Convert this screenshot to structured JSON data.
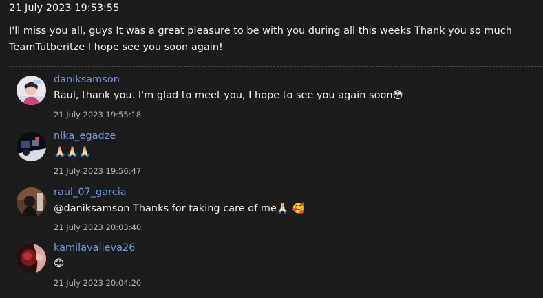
{
  "post": {
    "timestamp": "21 July 2023 19:53:55",
    "text_line1": "I'll miss you all, guys It was a great pleasure to be with you during all this weeks Thank you so much",
    "text_line2": "TeamTutberitze I hope see you soon again!"
  },
  "replies": [
    {
      "author": "daniksamson",
      "text": "Raul, thank you. I'm glad to meet you, I hope to see you again soon😳",
      "time": "21 July 2023 19:55:18",
      "avatar_icon": "user-avatar-daniksamson"
    },
    {
      "author": "nika_egadze",
      "text": "🙏🏻🙏🏻🙏🏻",
      "time": "21 July 2023 19:56:47",
      "avatar_icon": "user-avatar-nika-egadze"
    },
    {
      "author": "raul_07_garcia",
      "text": "@daniksamson Thanks for taking care of me🙏🏻 🥰",
      "time": "21 July 2023 20:03:40",
      "avatar_icon": "user-avatar-raul-07-garcia"
    },
    {
      "author": "kamilavalieva26",
      "text": "😊",
      "time": "21 July 2023 20:04:20",
      "avatar_icon": "user-avatar-kamilavalieva26"
    }
  ],
  "colors": {
    "background": "#1c1c1d",
    "author_link": "#6f9bdc",
    "text": "#f0f0f0",
    "muted": "#b4b4b4"
  }
}
